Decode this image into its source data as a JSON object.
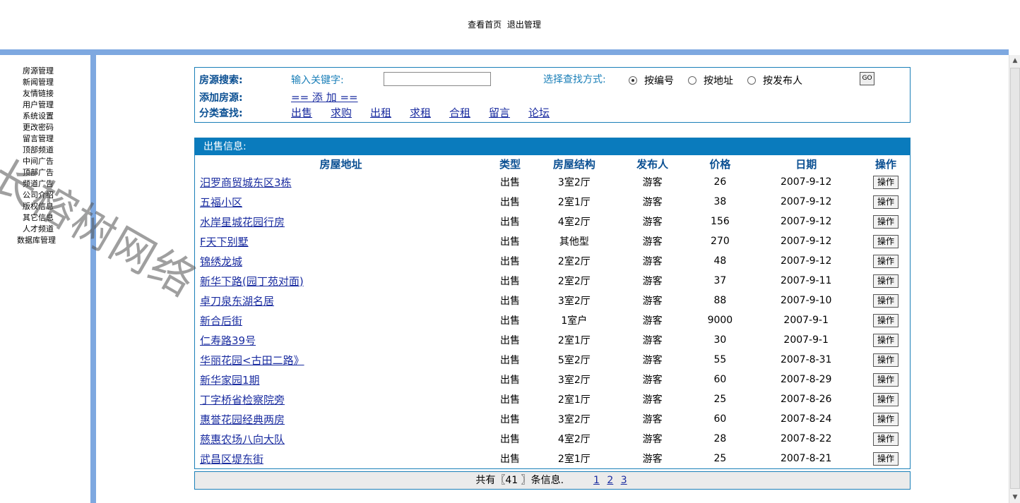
{
  "header": {
    "view_home": "查看首页",
    "logout": "退出管理"
  },
  "sidebar": {
    "items": [
      "房源管理",
      "新闻管理",
      "友情链接",
      "用户管理",
      "系统设置",
      "更改密码",
      "留言管理",
      "顶部频道",
      "中间广告",
      "顶部广告",
      "频道广告",
      "公司介绍",
      "版权信息",
      "其它信息",
      "人才频道",
      "数据库管理"
    ]
  },
  "watermark": "长榕树网络",
  "search": {
    "title": "房源搜索:",
    "keyword_label": "输入关键字:",
    "keyword_value": "",
    "method_label": "选择查找方式:",
    "options": [
      "按编号",
      "按地址",
      "按发布人"
    ],
    "selected": "按编号",
    "go": "GO",
    "add_label": "添加房源:",
    "add_link": "== 添 加 ==",
    "category_label": "分类查找:",
    "categories": [
      "出售",
      "求购",
      "出租",
      "求租",
      "合租",
      "留言",
      "论坛"
    ]
  },
  "listing": {
    "title": "出售信息:",
    "columns": [
      "房屋地址",
      "类型",
      "房屋结构",
      "发布人",
      "价格",
      "日期",
      "操作"
    ],
    "op_label": "操作",
    "rows": [
      [
        "汨罗商贸城东区3栋",
        "出售",
        "3室2厅",
        "游客",
        "26",
        "2007-9-12"
      ],
      [
        "五福小区",
        "出售",
        "2室1厅",
        "游客",
        "38",
        "2007-9-12"
      ],
      [
        "水岸星城花园行房",
        "出售",
        "4室2厅",
        "游客",
        "156",
        "2007-9-12"
      ],
      [
        "F天下别墅",
        "出售",
        "其他型",
        "游客",
        "270",
        "2007-9-12"
      ],
      [
        "锦绣龙城",
        "出售",
        "2室2厅",
        "游客",
        "48",
        "2007-9-12"
      ],
      [
        "新华下路(园丁苑对面)",
        "出售",
        "2室2厅",
        "游客",
        "37",
        "2007-9-11"
      ],
      [
        "卓刀泉东湖名居",
        "出售",
        "3室2厅",
        "游客",
        "88",
        "2007-9-10"
      ],
      [
        "新合后街",
        "出售",
        "1室户",
        "游客",
        "9000",
        "2007-9-1"
      ],
      [
        "仁寿路39号",
        "出售",
        "2室1厅",
        "游客",
        "30",
        "2007-9-1"
      ],
      [
        "华丽花园<古田二路》",
        "出售",
        "5室2厅",
        "游客",
        "55",
        "2007-8-31"
      ],
      [
        "新华家园1期",
        "出售",
        "3室2厅",
        "游客",
        "60",
        "2007-8-29"
      ],
      [
        "丁字桥省检察院旁",
        "出售",
        "2室1厅",
        "游客",
        "25",
        "2007-8-26"
      ],
      [
        "惠誉花园经典两房",
        "出售",
        "3室2厅",
        "游客",
        "60",
        "2007-8-24"
      ],
      [
        "慈惠农场八向大队",
        "出售",
        "4室2厅",
        "游客",
        "28",
        "2007-8-22"
      ],
      [
        "武昌区堤东街",
        "出售",
        "2室1厅",
        "游客",
        "25",
        "2007-8-21"
      ]
    ]
  },
  "footer": {
    "total_text": "共有〖41 〗条信息.",
    "pages": [
      "1",
      "2",
      "3"
    ]
  },
  "scrollbar": {
    "up": "▲",
    "down": "▼"
  }
}
